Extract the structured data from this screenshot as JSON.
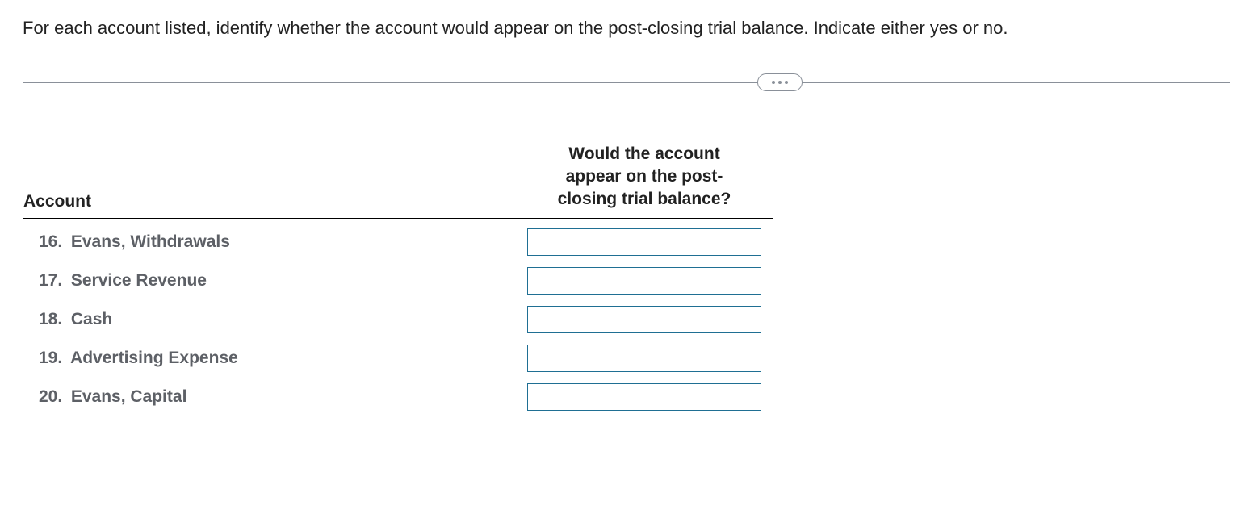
{
  "prompt": "For each account listed, identify whether the account would appear on the post-closing trial balance. Indicate either yes or no.",
  "headers": {
    "account": "Account",
    "question_line1": "Would the account",
    "question_line2": "appear on the post-",
    "question_line3": "closing trial balance?"
  },
  "rows": [
    {
      "num": "16.",
      "name": "Evans, Withdrawals",
      "value": ""
    },
    {
      "num": "17.",
      "name": "Service Revenue",
      "value": ""
    },
    {
      "num": "18.",
      "name": "Cash",
      "value": ""
    },
    {
      "num": "19.",
      "name": "Advertising Expense",
      "value": ""
    },
    {
      "num": "20.",
      "name": "Evans, Capital",
      "value": ""
    }
  ]
}
